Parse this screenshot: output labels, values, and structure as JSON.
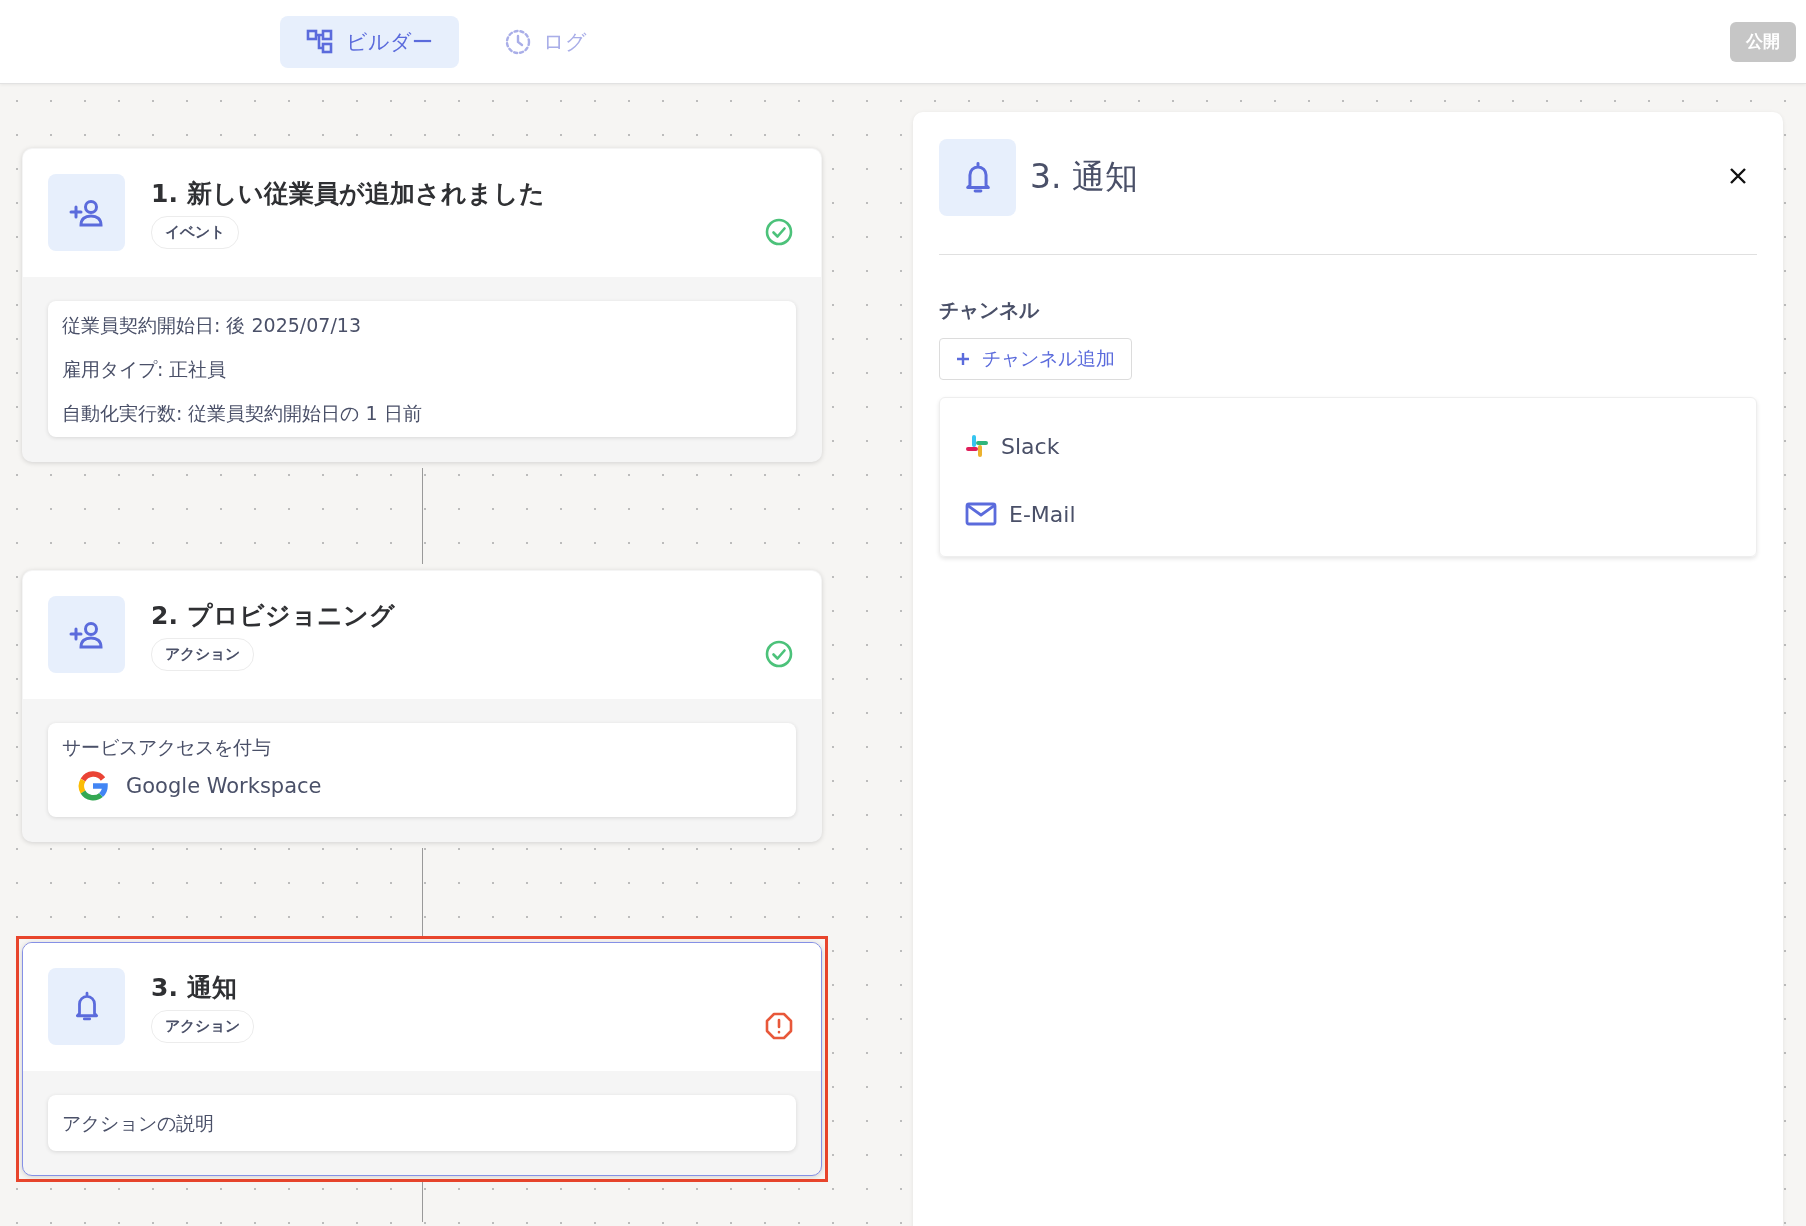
{
  "tabs": [
    {
      "kind": "builder",
      "label": "ビルダー",
      "selected": true
    },
    {
      "kind": "log",
      "label": "ログ",
      "selected": false
    }
  ],
  "publish_button": {
    "label": "公開",
    "disabled": true
  },
  "steps": [
    {
      "kind": "trigger",
      "title": "1. 新しい従業員が追加されました",
      "tag": "イベント",
      "valid": true,
      "selected": false,
      "body": {
        "kind": "conditions",
        "lines": [
          "従業員契約開始日: 後 2025/07/13",
          "雇用タイプ: 正社員",
          "自動化実行数: 従業員契約開始日の 1 日前"
        ]
      }
    },
    {
      "kind": "provisioning",
      "title": "2. プロビジョニング",
      "tag": "アクション",
      "valid": true,
      "selected": false,
      "body": {
        "kind": "service",
        "text": "サービスアクセスを付与",
        "service": "Google Workspace"
      }
    },
    {
      "kind": "notification",
      "title": "3. 通知",
      "tag": "アクション",
      "valid": false,
      "selected": true,
      "body": {
        "kind": "description",
        "text": "アクションの説明"
      }
    }
  ],
  "panel": {
    "title": "3. 通知",
    "section_label": "チャンネル",
    "add_button": "チャンネル追加",
    "channels": [
      {
        "kind": "slack",
        "name": "Slack"
      },
      {
        "kind": "email",
        "name": "E-Mail"
      }
    ]
  }
}
